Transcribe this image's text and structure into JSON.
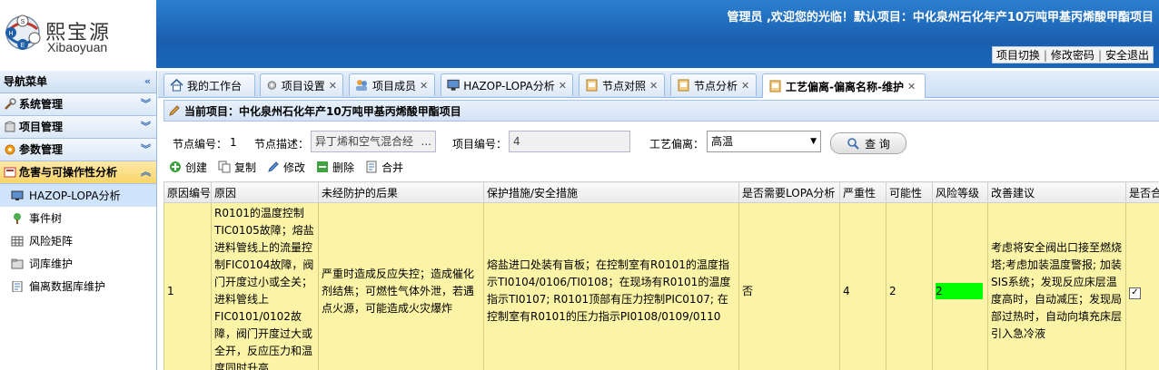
{
  "app": {
    "logo_cn": "熙宝源",
    "logo_en": "Xibaoyuan",
    "welcome": "管理员 ,欢迎您的光临！默认项目：中化泉州石化年产10万吨甲基丙烯酸甲酯项目",
    "top_links": [
      "项目切换",
      "修改密码",
      "安全退出"
    ],
    "brand_color": "#1a5fae"
  },
  "sidebar": {
    "title": "导航菜单",
    "groups": [
      {
        "label": "系统管理",
        "icon": "wrench-icon"
      },
      {
        "label": "项目管理",
        "icon": "box-icon"
      },
      {
        "label": "参数管理",
        "icon": "gear-icon"
      },
      {
        "label": "危害与可操作性分析",
        "icon": "analysis-icon"
      }
    ],
    "items": [
      {
        "label": "HAZOP-LOPA分析",
        "icon": "monitor-icon"
      },
      {
        "label": "事件树",
        "icon": "tree-icon"
      },
      {
        "label": "风险矩阵",
        "icon": "grid-icon"
      },
      {
        "label": "词库维护",
        "icon": "folder-icon"
      },
      {
        "label": "偏离数据库维护",
        "icon": "doc-icon"
      }
    ]
  },
  "tabs": [
    {
      "label": "我的工作台",
      "icon": "home-icon",
      "closable": false
    },
    {
      "label": "项目设置",
      "icon": "settings-icon",
      "closable": true
    },
    {
      "label": "项目成员",
      "icon": "users-icon",
      "closable": true
    },
    {
      "label": "HAZOP-LOPA分析",
      "icon": "monitor-icon",
      "closable": true
    },
    {
      "label": "节点对照",
      "icon": "page-icon",
      "closable": true
    },
    {
      "label": "节点分析",
      "icon": "page-icon",
      "closable": true
    },
    {
      "label": "工艺偏离-偏离名称-维护",
      "icon": "page-icon",
      "closable": true
    }
  ],
  "project_bar": "当前项目：中化泉州石化年产10万吨甲基丙烯酸甲酯项目",
  "form": {
    "node_no_label": "节点编号：",
    "node_no_value": "1",
    "node_desc_label": "节点描述：",
    "node_desc_value": "异丁烯和空气混合经",
    "node_desc_more": "...",
    "project_no_label": "项目编号：",
    "project_no_value": "4",
    "deviation_label": "工艺偏离：",
    "deviation_value": "高温",
    "query_button": "查 询"
  },
  "toolbar": [
    "创建",
    "复制",
    "修改",
    "删除",
    "合并"
  ],
  "table": {
    "columns": [
      "原因编号",
      "原因",
      "未经防护的后果",
      "保护措施/安全措施",
      "是否需要LOPA分析",
      "严重性",
      "可能性",
      "风险等级",
      "改善建议",
      "是否合"
    ],
    "rows": [
      {
        "id": "1",
        "cause": "R0101的温度控制TIC0105故障；熔盐进料管线上的流量控制FIC0104故障，阀门开度过小或全关；进料管线上FIC0101/0102故障，阀门开度过大或全开，反应压力和温度同时升高",
        "consequence": "严重时造成反应失控；造成催化剂结焦；可燃性气体外泄，若遇点火源，可能造成火灾爆炸",
        "safeguards": "熔盐进口处装有盲板；在控制室有R0101的温度指示TI0104/0106/TI0108；在现场有R0101的温度指示TI0107; R0101顶部有压力控制PIC0107; 在控制室有R0101的压力指示PI0108/0109/0110",
        "need_lopa": "否",
        "severity": "4",
        "likelihood": "2",
        "risk": "2",
        "risk_color": "#00ff00",
        "recommendation": "考虑将安全阀出口接至燃烧塔;考虑加装温度警报; 加装SIS系统；发现反应床层温度高时，自动减压；发现局部过热时，自动向填充床层引入急冷液",
        "checked": true
      }
    ]
  }
}
